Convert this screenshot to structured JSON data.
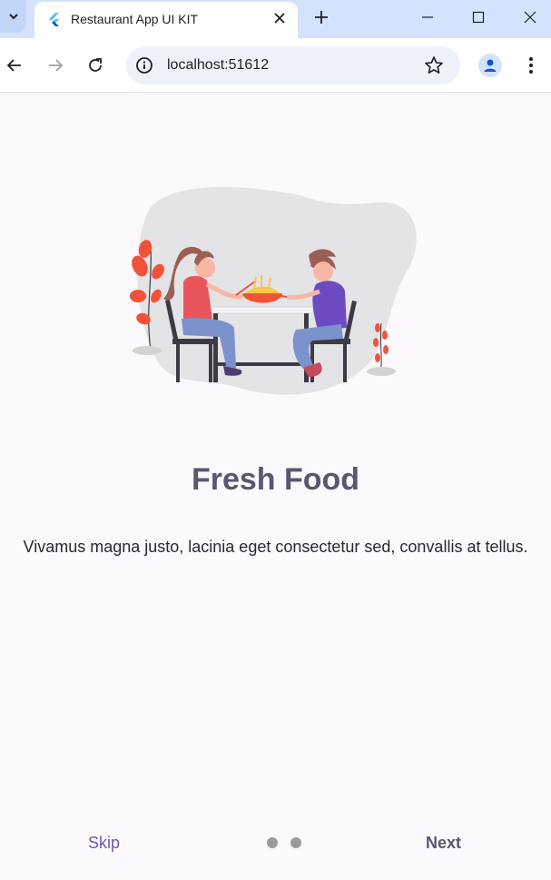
{
  "browser": {
    "tab_title": "Restaurant App UI KIT",
    "url": "localhost:51612",
    "icons": {
      "tab_search": "chevron-down-icon",
      "favicon": "flutter-icon",
      "tab_close": "close-icon",
      "new_tab": "plus-icon",
      "minimize": "minimize-icon",
      "maximize": "maximize-icon",
      "close_window": "close-icon",
      "back": "arrow-left-icon",
      "forward": "arrow-right-icon",
      "reload": "reload-icon",
      "site_info": "info-icon",
      "bookmark": "star-icon",
      "profile": "person-icon",
      "menu": "kebab-menu-icon"
    }
  },
  "onboarding": {
    "title": "Fresh Food",
    "description": "Vivamus magna justo, lacinia eget consectetur sed, convallis at tellus.",
    "skip_label": "Skip",
    "next_label": "Next",
    "page_count": 2,
    "current_page": 1
  },
  "colors": {
    "title": "#5a5670",
    "skip": "#6a58b5",
    "background": "#fbf9fc",
    "accent_red": "#f0533a",
    "shirt_purple": "#6c4bc3"
  }
}
